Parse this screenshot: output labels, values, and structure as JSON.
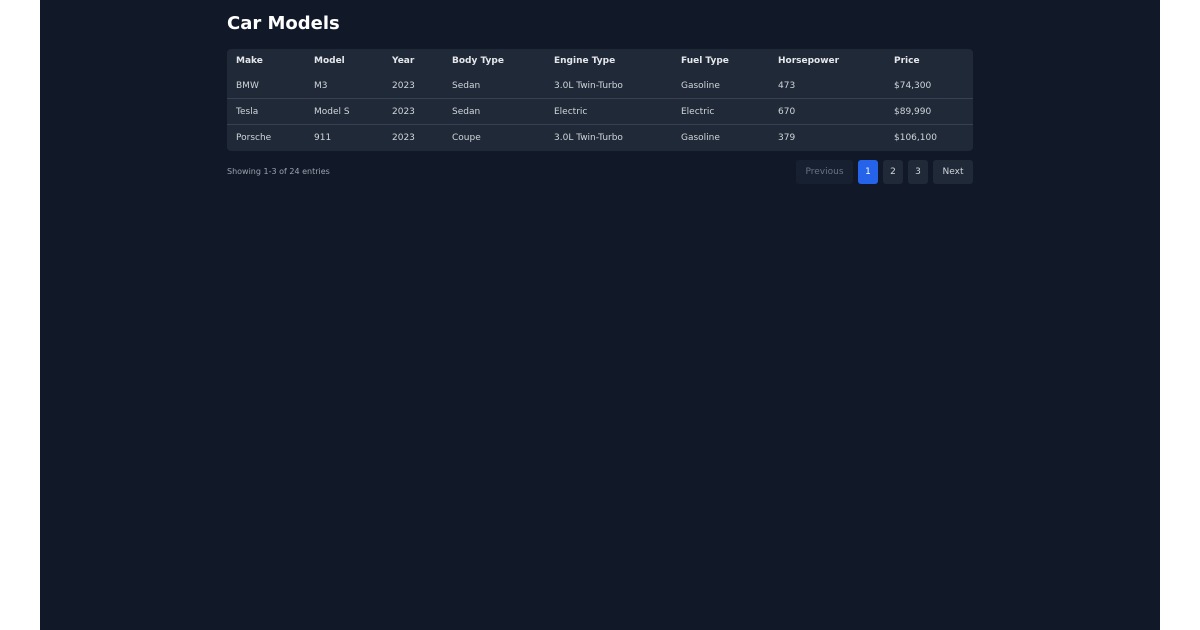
{
  "page": {
    "title": "Car Models"
  },
  "table": {
    "headers": [
      "Make",
      "Model",
      "Year",
      "Body Type",
      "Engine Type",
      "Fuel Type",
      "Horsepower",
      "Price"
    ],
    "rows": [
      [
        "BMW",
        "M3",
        "2023",
        "Sedan",
        "3.0L Twin-Turbo",
        "Gasoline",
        "473",
        "$74,300"
      ],
      [
        "Tesla",
        "Model S",
        "2023",
        "Sedan",
        "Electric",
        "Electric",
        "670",
        "$89,990"
      ],
      [
        "Porsche",
        "911",
        "2023",
        "Coupe",
        "3.0L Twin-Turbo",
        "Gasoline",
        "379",
        "$106,100"
      ]
    ]
  },
  "footer": {
    "entries_text": "Showing 1-3 of 24 entries"
  },
  "pagination": {
    "previous_label": "Previous",
    "pages": [
      "1",
      "2",
      "3"
    ],
    "next_label": "Next",
    "current_page": "1"
  },
  "colors": {
    "background": "#111827",
    "surface": "#1f2937",
    "accent": "#2563eb"
  }
}
